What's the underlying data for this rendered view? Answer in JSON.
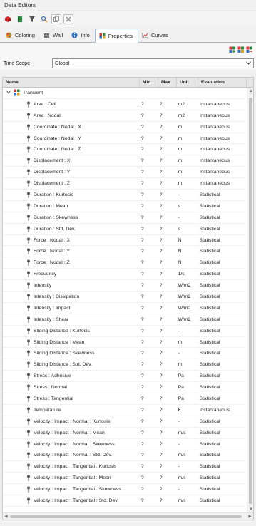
{
  "window": {
    "title": "Data Editors"
  },
  "toolbar": {
    "buttons": [
      "red-cube-icon",
      "green-book-icon",
      "filter-icon",
      "find-icon",
      "copy-icon",
      "delete-icon"
    ]
  },
  "tabs": [
    {
      "label": "Coloring",
      "icon": "palette-icon"
    },
    {
      "label": "Wall",
      "icon": "wall-icon"
    },
    {
      "label": "Info",
      "icon": "info-icon"
    },
    {
      "label": "Properties",
      "icon": "properties-icon",
      "active": true
    },
    {
      "label": "Curves",
      "icon": "curves-icon"
    }
  ],
  "time_scope": {
    "label": "Time Scope",
    "value": "Global"
  },
  "grid": {
    "headers": {
      "name": "Name",
      "min": "Min",
      "max": "Max",
      "unit": "Unit",
      "evaluation": "Evaluation"
    },
    "group": "Transient",
    "rows": [
      {
        "name": "Area : Cell",
        "min": "?",
        "max": "?",
        "unit": "m2",
        "eval": "Instantaneous"
      },
      {
        "name": "Area : Nodal",
        "min": "?",
        "max": "?",
        "unit": "m2",
        "eval": "Instantaneous"
      },
      {
        "name": "Coordinate : Nodal : X",
        "min": "?",
        "max": "?",
        "unit": "m",
        "eval": "Instantaneous"
      },
      {
        "name": "Coordinate : Nodal : Y",
        "min": "?",
        "max": "?",
        "unit": "m",
        "eval": "Instantaneous"
      },
      {
        "name": "Coordinate : Nodal : Z",
        "min": "?",
        "max": "?",
        "unit": "m",
        "eval": "Instantaneous"
      },
      {
        "name": "Displacement : X",
        "min": "?",
        "max": "?",
        "unit": "m",
        "eval": "Instantaneous"
      },
      {
        "name": "Displacement : Y",
        "min": "?",
        "max": "?",
        "unit": "m",
        "eval": "Instantaneous"
      },
      {
        "name": "Displacement : Z",
        "min": "?",
        "max": "?",
        "unit": "m",
        "eval": "Instantaneous"
      },
      {
        "name": "Duration : Kurtosis",
        "min": "?",
        "max": "?",
        "unit": "-",
        "eval": "Statistical"
      },
      {
        "name": "Duration : Mean",
        "min": "?",
        "max": "?",
        "unit": "s",
        "eval": "Statistical"
      },
      {
        "name": "Duration : Skewness",
        "min": "?",
        "max": "?",
        "unit": "-",
        "eval": "Statistical"
      },
      {
        "name": "Duration : Std. Dev.",
        "min": "?",
        "max": "?",
        "unit": "s",
        "eval": "Statistical"
      },
      {
        "name": "Force : Nodal : X",
        "min": "?",
        "max": "?",
        "unit": "N",
        "eval": "Statistical"
      },
      {
        "name": "Force : Nodal : Y",
        "min": "?",
        "max": "?",
        "unit": "N",
        "eval": "Statistical"
      },
      {
        "name": "Force : Nodal : Z",
        "min": "?",
        "max": "?",
        "unit": "N",
        "eval": "Statistical"
      },
      {
        "name": "Frequency",
        "min": "?",
        "max": "?",
        "unit": "1/s",
        "eval": "Statistical"
      },
      {
        "name": "Intensity",
        "min": "?",
        "max": "?",
        "unit": "W/m2",
        "eval": "Statistical"
      },
      {
        "name": "Intensity : Dissipation",
        "min": "?",
        "max": "?",
        "unit": "W/m2",
        "eval": "Statistical"
      },
      {
        "name": "Intensity : Impact",
        "min": "?",
        "max": "?",
        "unit": "W/m2",
        "eval": "Statistical"
      },
      {
        "name": "Intensity : Shear",
        "min": "?",
        "max": "?",
        "unit": "W/m2",
        "eval": "Statistical"
      },
      {
        "name": "Sliding Distance : Kurtosis",
        "min": "?",
        "max": "?",
        "unit": "-",
        "eval": "Statistical"
      },
      {
        "name": "Sliding Distance : Mean",
        "min": "?",
        "max": "?",
        "unit": "m",
        "eval": "Statistical"
      },
      {
        "name": "Sliding Distance : Skewness",
        "min": "?",
        "max": "?",
        "unit": "-",
        "eval": "Statistical"
      },
      {
        "name": "Sliding Distance : Std. Dev.",
        "min": "?",
        "max": "?",
        "unit": "m",
        "eval": "Statistical"
      },
      {
        "name": "Stress : Adhesive",
        "min": "?",
        "max": "?",
        "unit": "Pa",
        "eval": "Statistical"
      },
      {
        "name": "Stress : Normal",
        "min": "?",
        "max": "?",
        "unit": "Pa",
        "eval": "Statistical"
      },
      {
        "name": "Stress : Tangential",
        "min": "?",
        "max": "?",
        "unit": "Pa",
        "eval": "Statistical"
      },
      {
        "name": "Temperature",
        "min": "?",
        "max": "?",
        "unit": "K",
        "eval": "Instantaneous"
      },
      {
        "name": "Velocity : Impact : Normal : Kurtosis",
        "min": "?",
        "max": "?",
        "unit": "-",
        "eval": "Statistical"
      },
      {
        "name": "Velocity : Impact : Normal : Mean",
        "min": "?",
        "max": "?",
        "unit": "m/s",
        "eval": "Statistical"
      },
      {
        "name": "Velocity : Impact : Normal : Skewness",
        "min": "?",
        "max": "?",
        "unit": "-",
        "eval": "Statistical"
      },
      {
        "name": "Velocity : Impact : Normal : Std. Dev.",
        "min": "?",
        "max": "?",
        "unit": "m/s",
        "eval": "Statistical"
      },
      {
        "name": "Velocity : Impact : Tangential : Kurtosis",
        "min": "?",
        "max": "?",
        "unit": "-",
        "eval": "Statistical"
      },
      {
        "name": "Velocity : Impact : Tangential : Mean",
        "min": "?",
        "max": "?",
        "unit": "m/s",
        "eval": "Statistical"
      },
      {
        "name": "Velocity : Impact : Tangential : Skewness",
        "min": "?",
        "max": "?",
        "unit": "-",
        "eval": "Statistical"
      },
      {
        "name": "Velocity : Impact : Tangential : Std. Dev.",
        "min": "?",
        "max": "?",
        "unit": "m/s",
        "eval": "Statistical"
      }
    ]
  }
}
